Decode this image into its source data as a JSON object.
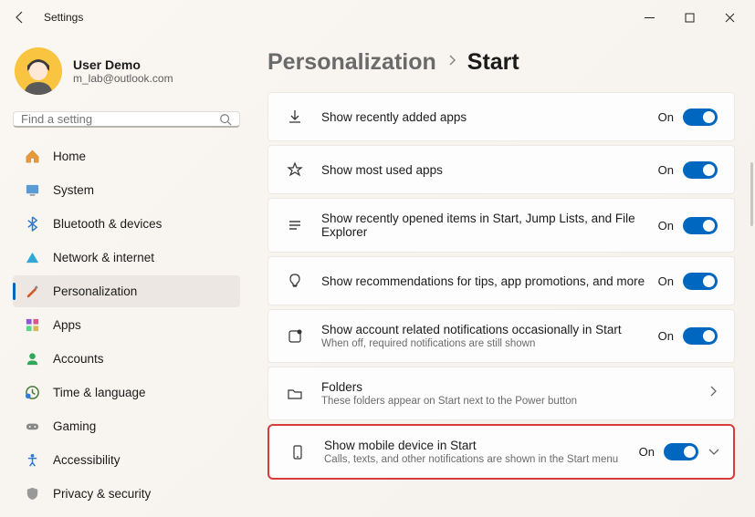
{
  "window": {
    "title": "Settings"
  },
  "user": {
    "name": "User Demo",
    "email": "m_lab@outlook.com"
  },
  "search": {
    "placeholder": "Find a setting"
  },
  "nav": {
    "items": [
      {
        "label": "Home"
      },
      {
        "label": "System"
      },
      {
        "label": "Bluetooth & devices"
      },
      {
        "label": "Network & internet"
      },
      {
        "label": "Personalization"
      },
      {
        "label": "Apps"
      },
      {
        "label": "Accounts"
      },
      {
        "label": "Time & language"
      },
      {
        "label": "Gaming"
      },
      {
        "label": "Accessibility"
      },
      {
        "label": "Privacy & security"
      }
    ]
  },
  "breadcrumb": {
    "parent": "Personalization",
    "current": "Start"
  },
  "settings": [
    {
      "title": "Show recently added apps",
      "sub": "",
      "state": "On"
    },
    {
      "title": "Show most used apps",
      "sub": "",
      "state": "On"
    },
    {
      "title": "Show recently opened items in Start, Jump Lists, and File Explorer",
      "sub": "",
      "state": "On"
    },
    {
      "title": "Show recommendations for tips, app promotions, and more",
      "sub": "",
      "state": "On"
    },
    {
      "title": "Show account related notifications occasionally in Start",
      "sub": "When off, required notifications are still shown",
      "state": "On"
    },
    {
      "title": "Folders",
      "sub": "These folders appear on Start next to the Power button",
      "state": ""
    },
    {
      "title": "Show mobile device in Start",
      "sub": "Calls, texts, and other notifications are shown in the Start menu",
      "state": "On"
    }
  ]
}
